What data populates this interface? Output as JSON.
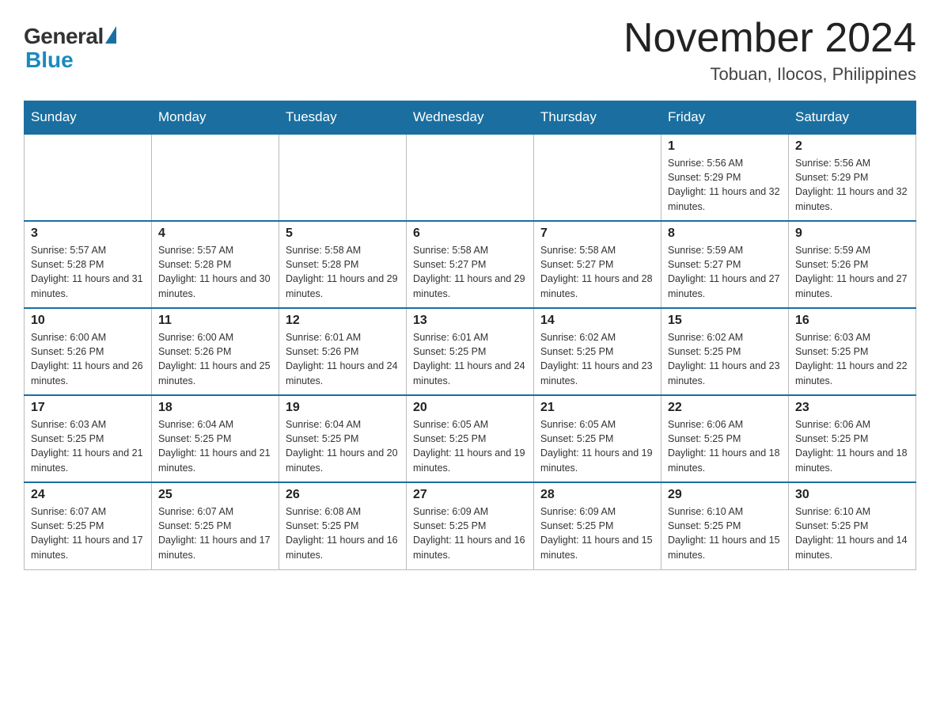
{
  "header": {
    "logo_general": "General",
    "logo_blue": "Blue",
    "month_title": "November 2024",
    "location": "Tobuan, Ilocos, Philippines"
  },
  "days_of_week": [
    "Sunday",
    "Monday",
    "Tuesday",
    "Wednesday",
    "Thursday",
    "Friday",
    "Saturday"
  ],
  "weeks": [
    [
      {
        "day": "",
        "sunrise": "",
        "sunset": "",
        "daylight": "",
        "empty": true
      },
      {
        "day": "",
        "sunrise": "",
        "sunset": "",
        "daylight": "",
        "empty": true
      },
      {
        "day": "",
        "sunrise": "",
        "sunset": "",
        "daylight": "",
        "empty": true
      },
      {
        "day": "",
        "sunrise": "",
        "sunset": "",
        "daylight": "",
        "empty": true
      },
      {
        "day": "",
        "sunrise": "",
        "sunset": "",
        "daylight": "",
        "empty": true
      },
      {
        "day": "1",
        "sunrise": "Sunrise: 5:56 AM",
        "sunset": "Sunset: 5:29 PM",
        "daylight": "Daylight: 11 hours and 32 minutes.",
        "empty": false
      },
      {
        "day": "2",
        "sunrise": "Sunrise: 5:56 AM",
        "sunset": "Sunset: 5:29 PM",
        "daylight": "Daylight: 11 hours and 32 minutes.",
        "empty": false
      }
    ],
    [
      {
        "day": "3",
        "sunrise": "Sunrise: 5:57 AM",
        "sunset": "Sunset: 5:28 PM",
        "daylight": "Daylight: 11 hours and 31 minutes.",
        "empty": false
      },
      {
        "day": "4",
        "sunrise": "Sunrise: 5:57 AM",
        "sunset": "Sunset: 5:28 PM",
        "daylight": "Daylight: 11 hours and 30 minutes.",
        "empty": false
      },
      {
        "day": "5",
        "sunrise": "Sunrise: 5:58 AM",
        "sunset": "Sunset: 5:28 PM",
        "daylight": "Daylight: 11 hours and 29 minutes.",
        "empty": false
      },
      {
        "day": "6",
        "sunrise": "Sunrise: 5:58 AM",
        "sunset": "Sunset: 5:27 PM",
        "daylight": "Daylight: 11 hours and 29 minutes.",
        "empty": false
      },
      {
        "day": "7",
        "sunrise": "Sunrise: 5:58 AM",
        "sunset": "Sunset: 5:27 PM",
        "daylight": "Daylight: 11 hours and 28 minutes.",
        "empty": false
      },
      {
        "day": "8",
        "sunrise": "Sunrise: 5:59 AM",
        "sunset": "Sunset: 5:27 PM",
        "daylight": "Daylight: 11 hours and 27 minutes.",
        "empty": false
      },
      {
        "day": "9",
        "sunrise": "Sunrise: 5:59 AM",
        "sunset": "Sunset: 5:26 PM",
        "daylight": "Daylight: 11 hours and 27 minutes.",
        "empty": false
      }
    ],
    [
      {
        "day": "10",
        "sunrise": "Sunrise: 6:00 AM",
        "sunset": "Sunset: 5:26 PM",
        "daylight": "Daylight: 11 hours and 26 minutes.",
        "empty": false
      },
      {
        "day": "11",
        "sunrise": "Sunrise: 6:00 AM",
        "sunset": "Sunset: 5:26 PM",
        "daylight": "Daylight: 11 hours and 25 minutes.",
        "empty": false
      },
      {
        "day": "12",
        "sunrise": "Sunrise: 6:01 AM",
        "sunset": "Sunset: 5:26 PM",
        "daylight": "Daylight: 11 hours and 24 minutes.",
        "empty": false
      },
      {
        "day": "13",
        "sunrise": "Sunrise: 6:01 AM",
        "sunset": "Sunset: 5:25 PM",
        "daylight": "Daylight: 11 hours and 24 minutes.",
        "empty": false
      },
      {
        "day": "14",
        "sunrise": "Sunrise: 6:02 AM",
        "sunset": "Sunset: 5:25 PM",
        "daylight": "Daylight: 11 hours and 23 minutes.",
        "empty": false
      },
      {
        "day": "15",
        "sunrise": "Sunrise: 6:02 AM",
        "sunset": "Sunset: 5:25 PM",
        "daylight": "Daylight: 11 hours and 23 minutes.",
        "empty": false
      },
      {
        "day": "16",
        "sunrise": "Sunrise: 6:03 AM",
        "sunset": "Sunset: 5:25 PM",
        "daylight": "Daylight: 11 hours and 22 minutes.",
        "empty": false
      }
    ],
    [
      {
        "day": "17",
        "sunrise": "Sunrise: 6:03 AM",
        "sunset": "Sunset: 5:25 PM",
        "daylight": "Daylight: 11 hours and 21 minutes.",
        "empty": false
      },
      {
        "day": "18",
        "sunrise": "Sunrise: 6:04 AM",
        "sunset": "Sunset: 5:25 PM",
        "daylight": "Daylight: 11 hours and 21 minutes.",
        "empty": false
      },
      {
        "day": "19",
        "sunrise": "Sunrise: 6:04 AM",
        "sunset": "Sunset: 5:25 PM",
        "daylight": "Daylight: 11 hours and 20 minutes.",
        "empty": false
      },
      {
        "day": "20",
        "sunrise": "Sunrise: 6:05 AM",
        "sunset": "Sunset: 5:25 PM",
        "daylight": "Daylight: 11 hours and 19 minutes.",
        "empty": false
      },
      {
        "day": "21",
        "sunrise": "Sunrise: 6:05 AM",
        "sunset": "Sunset: 5:25 PM",
        "daylight": "Daylight: 11 hours and 19 minutes.",
        "empty": false
      },
      {
        "day": "22",
        "sunrise": "Sunrise: 6:06 AM",
        "sunset": "Sunset: 5:25 PM",
        "daylight": "Daylight: 11 hours and 18 minutes.",
        "empty": false
      },
      {
        "day": "23",
        "sunrise": "Sunrise: 6:06 AM",
        "sunset": "Sunset: 5:25 PM",
        "daylight": "Daylight: 11 hours and 18 minutes.",
        "empty": false
      }
    ],
    [
      {
        "day": "24",
        "sunrise": "Sunrise: 6:07 AM",
        "sunset": "Sunset: 5:25 PM",
        "daylight": "Daylight: 11 hours and 17 minutes.",
        "empty": false
      },
      {
        "day": "25",
        "sunrise": "Sunrise: 6:07 AM",
        "sunset": "Sunset: 5:25 PM",
        "daylight": "Daylight: 11 hours and 17 minutes.",
        "empty": false
      },
      {
        "day": "26",
        "sunrise": "Sunrise: 6:08 AM",
        "sunset": "Sunset: 5:25 PM",
        "daylight": "Daylight: 11 hours and 16 minutes.",
        "empty": false
      },
      {
        "day": "27",
        "sunrise": "Sunrise: 6:09 AM",
        "sunset": "Sunset: 5:25 PM",
        "daylight": "Daylight: 11 hours and 16 minutes.",
        "empty": false
      },
      {
        "day": "28",
        "sunrise": "Sunrise: 6:09 AM",
        "sunset": "Sunset: 5:25 PM",
        "daylight": "Daylight: 11 hours and 15 minutes.",
        "empty": false
      },
      {
        "day": "29",
        "sunrise": "Sunrise: 6:10 AM",
        "sunset": "Sunset: 5:25 PM",
        "daylight": "Daylight: 11 hours and 15 minutes.",
        "empty": false
      },
      {
        "day": "30",
        "sunrise": "Sunrise: 6:10 AM",
        "sunset": "Sunset: 5:25 PM",
        "daylight": "Daylight: 11 hours and 14 minutes.",
        "empty": false
      }
    ]
  ]
}
